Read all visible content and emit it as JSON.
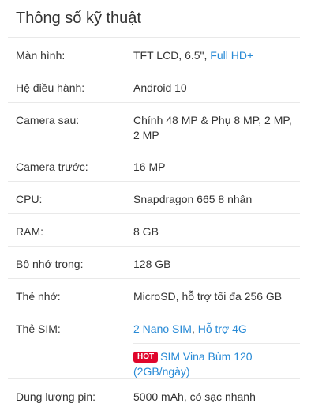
{
  "title": "Thông số kỹ thuật",
  "specs": [
    {
      "label": "Màn hình:",
      "plain": "TFT LCD, 6.5\", ",
      "link": "Full HD+"
    },
    {
      "label": "Hệ điều hành:",
      "link": "Android 10"
    },
    {
      "label": "Camera sau:",
      "link": "Chính 48 MP & Phụ 8 MP, 2 MP, 2 MP"
    },
    {
      "label": "Camera trước:",
      "plain": "16 MP"
    },
    {
      "label": "CPU:",
      "link": "Snapdragon 665 8 nhân"
    },
    {
      "label": "RAM:",
      "plain": "8 GB"
    },
    {
      "label": "Bộ nhớ trong:",
      "plain": "128 GB"
    },
    {
      "label": "Thẻ nhớ:",
      "link": "MicroSD, hỗ trợ tối đa 256 GB"
    },
    {
      "label": "Thẻ SIM:",
      "link": "2 Nano SIM",
      "sep": ", ",
      "link2": "Hỗ trợ 4G",
      "promo": {
        "badge": "HOT",
        "text": "SIM Vina Bùm 120",
        "text2": "(2GB/ngày)"
      }
    },
    {
      "label": "Dung lượng pin:",
      "plain": "5000 mAh, có sạc nhanh"
    }
  ],
  "colors": {
    "link": "#288ad6",
    "hot": "#e0052b",
    "text": "#333333",
    "divider": "#e9e9e9"
  }
}
